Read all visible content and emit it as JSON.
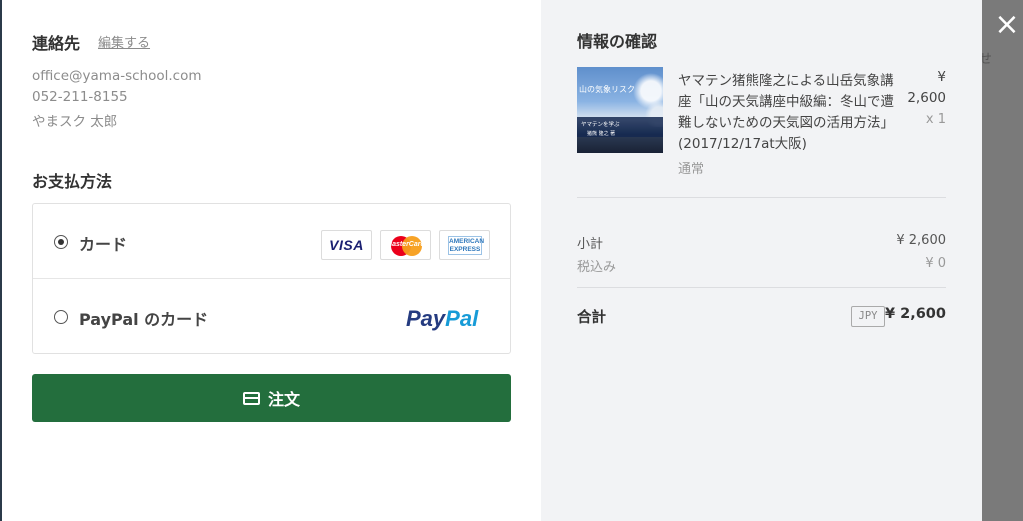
{
  "contact": {
    "title": "連絡先",
    "edit_label": "編集する",
    "email": "office@yama-school.com",
    "phone": "052-211-8155",
    "name": "やまスク 太郎"
  },
  "payment": {
    "title": "お支払方法",
    "options": [
      {
        "label": "カード",
        "selected": true
      },
      {
        "label": "PayPal のカード",
        "selected": false
      }
    ],
    "card_brands": [
      "VISA",
      "MasterCard",
      "AMERICAN EXPRESS"
    ],
    "paypal_logo": {
      "pay": "Pay",
      "pal": "Pal"
    }
  },
  "order_button": {
    "label": "注文",
    "icon": "credit-card-icon"
  },
  "close_icon": "×",
  "backdrop_text": "せ",
  "summary": {
    "title": "情報の確認",
    "item": {
      "thumbnail_title": "山の気象リスク",
      "thumbnail_sub": "ヤマテンを学ぶ",
      "thumbnail_sub2": "猪熊 隆之 著",
      "lines": [
        "ヤマテン猪熊隆之による山岳気象講",
        "座「山の天気講座中級編：冬山で遭",
        "難しないための天気図の活用方法」",
        "(2017/12/17at大阪)"
      ],
      "price_symbol": "¥",
      "price": "2,600",
      "qty": "x 1",
      "type": "通常"
    },
    "subtotal_label": "小計",
    "subtotal_value": "¥ 2,600",
    "tax_label": "税込み",
    "tax_value": "¥ 0",
    "total_label": "合計",
    "currency": "JPY",
    "total_value": "¥ 2,600"
  },
  "colors": {
    "accent_green": "#236e3d",
    "paypal_blue_dark": "#253b80",
    "paypal_blue_light": "#179bd7"
  }
}
